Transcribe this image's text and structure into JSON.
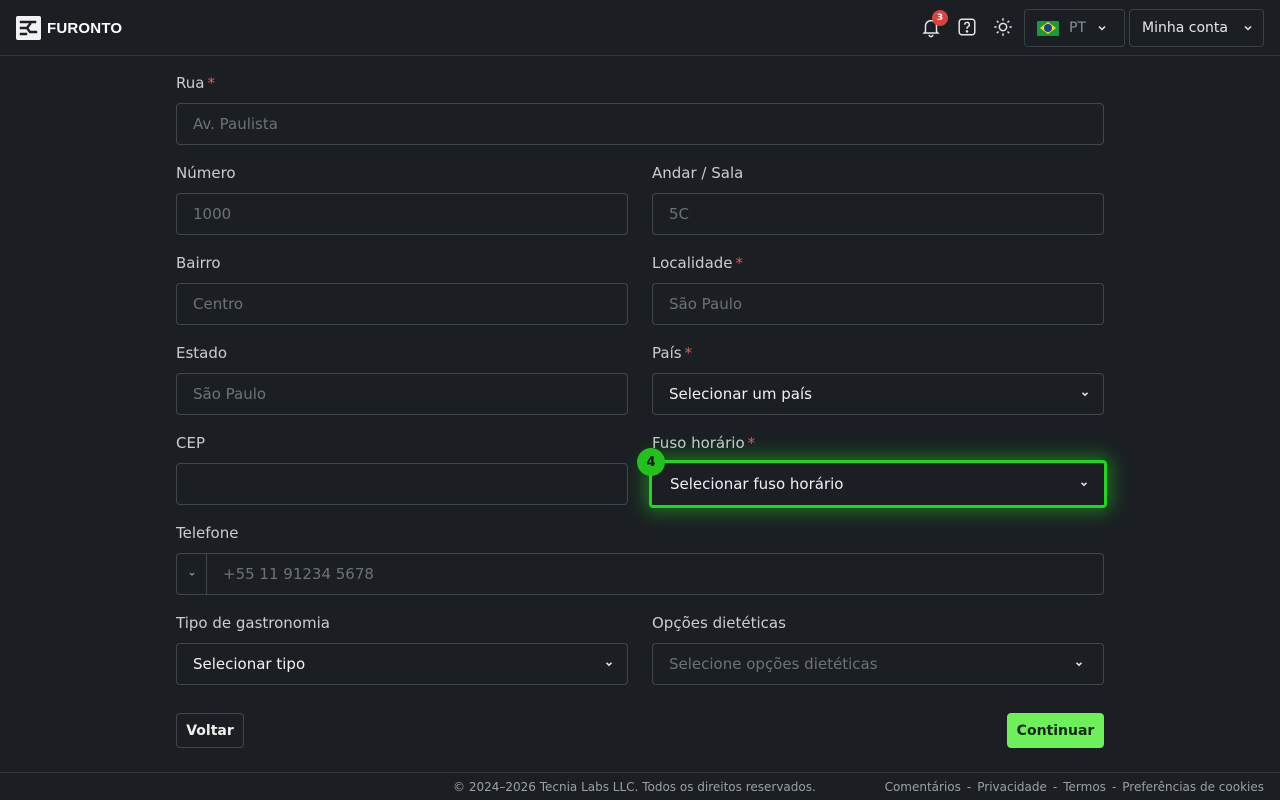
{
  "header": {
    "brand": "FURONTO",
    "notifications_count": "3",
    "language_code": "PT",
    "account_label": "Minha conta"
  },
  "form": {
    "street": {
      "label": "Rua",
      "placeholder": "Av. Paulista"
    },
    "number": {
      "label": "Número",
      "placeholder": "1000"
    },
    "floor": {
      "label": "Andar / Sala",
      "placeholder": "5C"
    },
    "neighborhood": {
      "label": "Bairro",
      "placeholder": "Centro"
    },
    "locality": {
      "label": "Localidade",
      "placeholder": "São Paulo"
    },
    "state": {
      "label": "Estado",
      "placeholder": "São Paulo"
    },
    "country": {
      "label": "País",
      "value": "Selecionar um país"
    },
    "zip": {
      "label": "CEP",
      "placeholder": ""
    },
    "timezone": {
      "label": "Fuso horário",
      "value": "Selecionar fuso horário",
      "marker": "4"
    },
    "phone": {
      "label": "Telefone",
      "placeholder": "+55 11 91234 5678"
    },
    "cuisine": {
      "label": "Tipo de gastronomia",
      "value": "Selecionar tipo"
    },
    "dietary": {
      "label": "Opções dietéticas",
      "value": "Selecione opções dietéticas"
    },
    "required_mark": "*",
    "back_label": "Voltar",
    "next_label": "Continuar"
  },
  "footer": {
    "copyright": "© 2024–2026 Tecnia Labs LLC. Todos os direitos reservados.",
    "links": [
      "Comentários",
      "Privacidade",
      "Termos",
      "Preferências de cookies"
    ],
    "separator": "-"
  },
  "colors": {
    "background": "#1b1f23",
    "accent": "#6ef05a",
    "highlight": "#22d61e",
    "required": "#e05a5a"
  },
  "icons": [
    "logo-icon",
    "bell-icon",
    "help-icon",
    "sun-icon",
    "brazil-flag-icon",
    "chevron-down-icon"
  ]
}
